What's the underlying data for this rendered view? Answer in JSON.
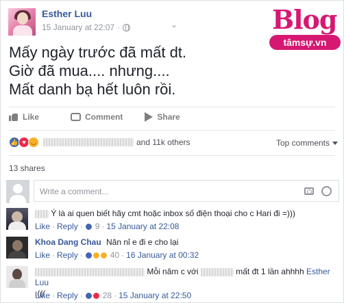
{
  "post": {
    "author": "Esther Luu",
    "timestamp": "15 January at 22:07",
    "privacy_icon": "globe-icon",
    "menu_icon": "chevron-down-icon",
    "lines": [
      "Mấy ngày trước đã mất dt.",
      "Giờ đã mua.... nhưng....",
      "Mất danh bạ hết luôn rồi."
    ]
  },
  "watermark": {
    "top": "Blog",
    "bottom": "tâmsự.vn",
    "color": "#d61872"
  },
  "actions": {
    "like": "Like",
    "comment": "Comment",
    "share": "Share"
  },
  "reactions": {
    "icons": [
      "like-icon",
      "love-icon",
      "haha-icon"
    ],
    "suffix": "and 11k others",
    "sort_label": "Top comments"
  },
  "shares": "13 shares",
  "composer": {
    "placeholder": "Write a comment..."
  },
  "comments": [
    {
      "name": "",
      "text": "Ý là ai quen biết hãy cmt hoặc inbox số điện thoại cho c Hari đi =)))",
      "like": "Like",
      "reply": "Reply",
      "sep": "·",
      "reaction_count": "9",
      "time": "15 January at 22:08"
    },
    {
      "name": "Khoa Dang Chau",
      "text": "Năn nỉ e đi e cho lại",
      "like": "Like",
      "reply": "Reply",
      "sep": "·",
      "reaction_count": "40",
      "time": "16 January at 00:32"
    },
    {
      "name": "",
      "text_a": "Mỗi năm c với",
      "text_b": "mất đt 1 lần ahhhh",
      "mention": "Esther Luu",
      "text_c": ":(((",
      "like": "Like",
      "reply": "Reply",
      "sep": "·",
      "reaction_count": "28",
      "time": "15 January at 22:50"
    }
  ],
  "colors": {
    "link": "#365899",
    "muted": "#90949c",
    "like_blue": "#4267b2",
    "love_red": "#f0284a",
    "haha_yellow": "#f7b125"
  }
}
